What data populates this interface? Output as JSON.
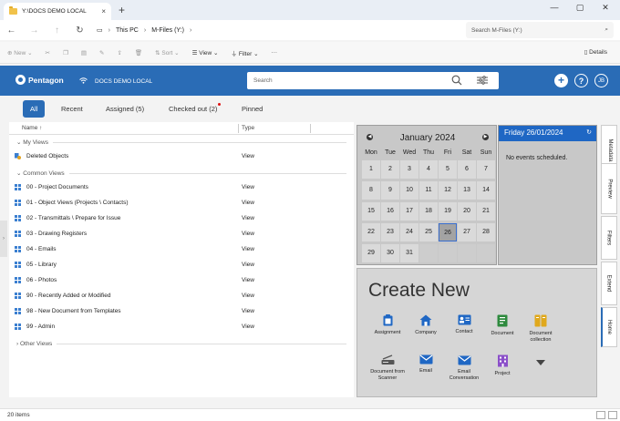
{
  "window": {
    "tab_title": "Y:\\DOCS DEMO LOCAL",
    "tab_close": "×",
    "new_tab": "+",
    "minimize": "—",
    "maximize": "▢",
    "close": "✕"
  },
  "address": {
    "crumbs": [
      "This PC",
      "M-Files (Y:)"
    ],
    "search_placeholder": "Search M-Files (Y:)"
  },
  "toolbar": {
    "new_label": "New",
    "sort_label": "Sort",
    "view_label": "View",
    "filter_label": "Filter",
    "more_label": "···",
    "details_label": "Details"
  },
  "mfiles": {
    "brand": "Pentagon",
    "vault": "DOCS DEMO LOCAL",
    "search_placeholder": "Search",
    "user_initials": "JB"
  },
  "view_tabs": [
    "All",
    "Recent",
    "Assigned (5)",
    "Checked out (2)",
    "Pinned"
  ],
  "list": {
    "col_name": "Name",
    "col_name_sort": "↑",
    "col_type": "Type",
    "group_my_views": "My Views",
    "group_common_views": "Common Views",
    "group_other_views": "Other Views",
    "my_views": [
      {
        "name": "Deleted Objects",
        "type": "View"
      }
    ],
    "common_views": [
      {
        "name": "00 - Project Documents",
        "type": "View"
      },
      {
        "name": "01 - Object Views (Projects \\ Contacts)",
        "type": "View"
      },
      {
        "name": "02 - Transmittals \\ Prepare for Issue",
        "type": "View"
      },
      {
        "name": "03 - Drawing Registers",
        "type": "View"
      },
      {
        "name": "04 - Emails",
        "type": "View"
      },
      {
        "name": "05 - Library",
        "type": "View"
      },
      {
        "name": "06 - Photos",
        "type": "View"
      },
      {
        "name": "90 - Recently Added or Modified",
        "type": "View"
      },
      {
        "name": "98 - New Document from Templates",
        "type": "View"
      },
      {
        "name": "99 - Admin",
        "type": "View"
      }
    ]
  },
  "calendar": {
    "title": "January 2024",
    "weekdays": [
      "Mon",
      "Tue",
      "Wed",
      "Thu",
      "Fri",
      "Sat",
      "Sun"
    ],
    "weeks": [
      [
        "1",
        "2",
        "3",
        "4",
        "5",
        "6",
        "7"
      ],
      [
        "8",
        "9",
        "10",
        "11",
        "12",
        "13",
        "14"
      ],
      [
        "15",
        "16",
        "17",
        "18",
        "19",
        "20",
        "21"
      ],
      [
        "22",
        "23",
        "24",
        "25",
        "26",
        "27",
        "28"
      ],
      [
        "29",
        "30",
        "31",
        "",
        "",
        "",
        ""
      ]
    ],
    "selected_day": "26"
  },
  "events": {
    "date_heading": "Friday 26/01/2024",
    "empty_text": "No events scheduled."
  },
  "create_new": {
    "title": "Create New",
    "items": [
      "Assignment",
      "Company",
      "Contact",
      "Document",
      "Document collection",
      "Document from Scanner",
      "Email",
      "Email Conversation",
      "Project"
    ]
  },
  "side_tabs": [
    "Metadata",
    "Preview",
    "Filters",
    "Extend",
    "Home"
  ],
  "status": {
    "item_count": "20 items"
  },
  "colors": {
    "accent": "#2a6cb6",
    "event_header": "#1f67c4",
    "calendar_bg": "#c8c8c8",
    "badge_red": "#d11111"
  }
}
